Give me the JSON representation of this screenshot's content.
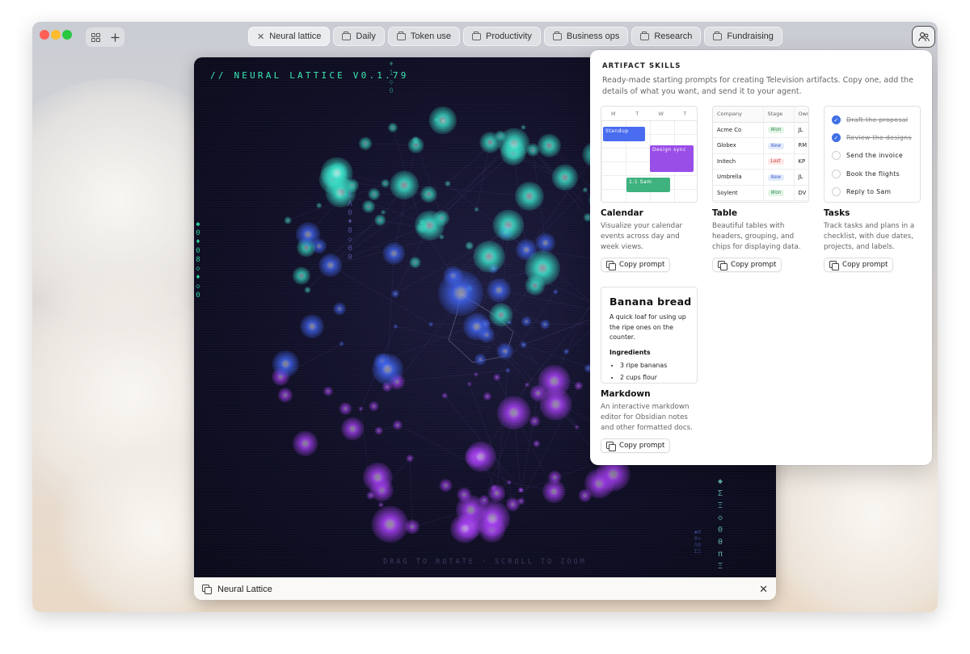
{
  "window": {
    "tabs": [
      {
        "label": "Neural lattice",
        "active": true,
        "icon": "close-icon"
      },
      {
        "label": "Daily",
        "icon": "folder-icon"
      },
      {
        "label": "Token use",
        "icon": "folder-icon"
      },
      {
        "label": "Productivity",
        "icon": "folder-icon"
      },
      {
        "label": "Business ops",
        "icon": "folder-icon"
      },
      {
        "label": "Research",
        "icon": "folder-icon"
      },
      {
        "label": "Fundraising",
        "icon": "folder-icon"
      }
    ],
    "toolbar": {
      "grid_icon": "grid-icon",
      "add_icon": "plus-icon",
      "account_icon": "people-icon"
    }
  },
  "artifact": {
    "title": "// NEURAL LATTICE V0.1.79",
    "hint": "DRAG TO ROTATE · SCROLL TO ZOOM",
    "footer_title": "Neural Lattice",
    "rain_left": "◆0♦08◇♦◇0",
    "rain_mid": "ΣΛ0♦8◇00",
    "rain_top": "♦1◇0",
    "rain_right1": "◆ΣΞ◇0θπΞ",
    "rain_right2": "◆08◇Λ0ΣΞ",
    "colors": {
      "accent": "#3ce7b4",
      "node_cyan": "#38e0c8",
      "node_blue": "#3f63f0",
      "node_violet": "#a33df0"
    }
  },
  "panel": {
    "title": "ARTIFACT SKILLS",
    "description": "Ready-made starting prompts for creating Television artifacts. Copy one, add the details of what you want, and send it to your agent.",
    "copy_label": "Copy prompt",
    "cards": {
      "calendar": {
        "title": "Calendar",
        "desc": "Visualize your calendar events across day and week views.",
        "days": [
          "M",
          "T",
          "W",
          "T"
        ],
        "events": [
          {
            "label": "Standup",
            "color": "#4a6cf0"
          },
          {
            "label": "Design sync",
            "color": "#9a4ee8"
          },
          {
            "label": "1:1 Sam",
            "color": "#3fb27f"
          }
        ]
      },
      "table": {
        "title": "Table",
        "desc": "Beautiful tables with headers, grouping, and chips for displaying data.",
        "headers": [
          "Company",
          "Stage",
          "Own"
        ],
        "rows": [
          {
            "company": "Acme Co",
            "stage": "Won",
            "owner": "JL"
          },
          {
            "company": "Globex",
            "stage": "New",
            "owner": "RM"
          },
          {
            "company": "Initech",
            "stage": "Lost",
            "owner": "KP"
          },
          {
            "company": "Umbrella",
            "stage": "New",
            "owner": "JL"
          },
          {
            "company": "Soylent",
            "stage": "Won",
            "owner": "DV"
          }
        ],
        "chip_colors": {
          "Won": [
            "#e3f5e8",
            "#2f8a4a"
          ],
          "New": [
            "#e3ebfc",
            "#3c5fc8"
          ],
          "Lost": [
            "#fde6e6",
            "#c23a3a"
          ]
        }
      },
      "tasks": {
        "title": "Tasks",
        "desc": "Track tasks and plans in a checklist, with due dates, projects, and labels.",
        "items": [
          {
            "label": "Draft the proposal",
            "done": true
          },
          {
            "label": "Review the designs",
            "done": true
          },
          {
            "label": "Send the invoice",
            "done": false
          },
          {
            "label": "Book the flights",
            "done": false
          },
          {
            "label": "Reply to Sam",
            "done": false
          }
        ]
      },
      "markdown": {
        "title": "Markdown",
        "desc": "An interactive markdown editor for Obsidian notes and other formatted docs.",
        "doc_title": "Banana bread",
        "doc_body": "A quick loaf for using up the ripe ones on the counter.",
        "doc_sub": "Ingredients",
        "doc_items": [
          "3 ripe bananas",
          "2 cups flour"
        ]
      }
    }
  }
}
